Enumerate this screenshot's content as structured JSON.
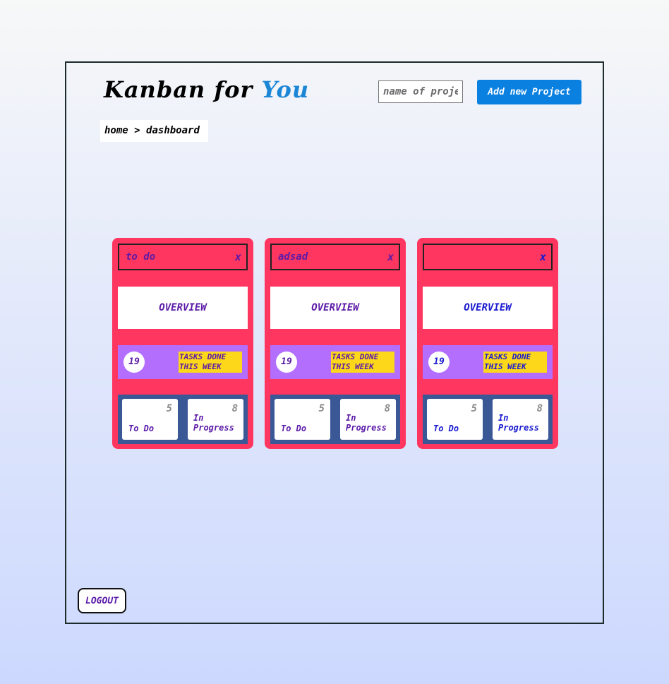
{
  "header": {
    "title_part1": "Kanban for",
    "title_part2": "You",
    "project_input_placeholder": "name of project",
    "add_button_label": "Add new Project"
  },
  "breadcrumb": {
    "home": "home",
    "separator": ">",
    "current": "dashboard"
  },
  "colors": {
    "card_background": "#ff365f",
    "title_accent": "#1c86d6",
    "add_button": "#0a80e0",
    "tasks_bar": "#b36efe",
    "tasks_label": "#fcd71a",
    "stats_panel": "#3b5896"
  },
  "projects": [
    {
      "name": "to do",
      "close_label": "x",
      "overview_label": "OVERVIEW",
      "tasks_done_count": "19",
      "tasks_done_label": "tasks done this week",
      "todo_count": "5",
      "todo_label": "To Do",
      "in_progress_count": "8",
      "in_progress_label": "In Progress",
      "text_color": "#5b1aa8"
    },
    {
      "name": "adsad",
      "close_label": "x",
      "overview_label": "OVERVIEW",
      "tasks_done_count": "19",
      "tasks_done_label": "tasks done this week",
      "todo_count": "5",
      "todo_label": "To Do",
      "in_progress_count": "8",
      "in_progress_label": "In Progress",
      "text_color": "#5b1aa8"
    },
    {
      "name": "",
      "close_label": "x",
      "overview_label": "OVERVIEW",
      "tasks_done_count": "19",
      "tasks_done_label": "tasks done this week",
      "todo_count": "5",
      "todo_label": "To Do",
      "in_progress_count": "8",
      "in_progress_label": "In Progress",
      "text_color": "#1a1ad0"
    }
  ],
  "footer": {
    "logout_label": "LOGOUT"
  }
}
